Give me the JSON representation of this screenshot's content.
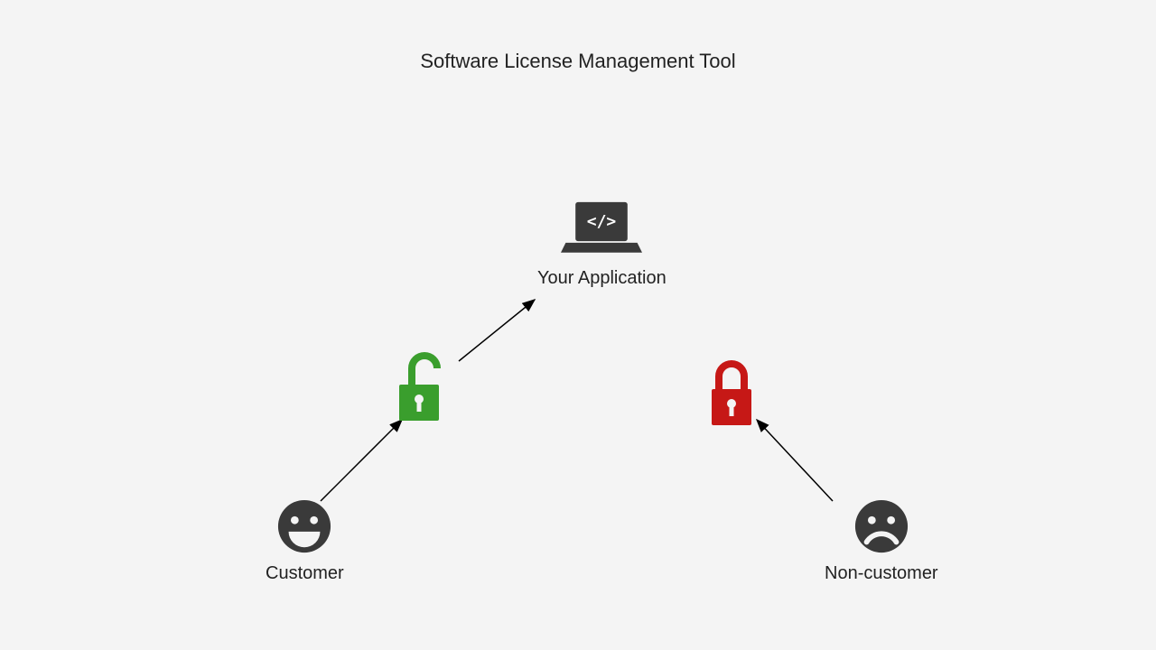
{
  "title": "Software License Management Tool",
  "nodes": {
    "application": {
      "label": "Your Application",
      "icon": "laptop-code"
    },
    "customer": {
      "label": "Customer",
      "icon": "face-happy"
    },
    "noncustomer": {
      "label": "Non-customer",
      "icon": "face-sad"
    },
    "unlocked": {
      "icon": "lock-open",
      "color": "#3a9e2d"
    },
    "locked": {
      "icon": "lock-closed",
      "color": "#c61816"
    }
  },
  "colors": {
    "dark": "#3a3a3a",
    "green": "#3a9e2d",
    "red": "#c61816"
  }
}
